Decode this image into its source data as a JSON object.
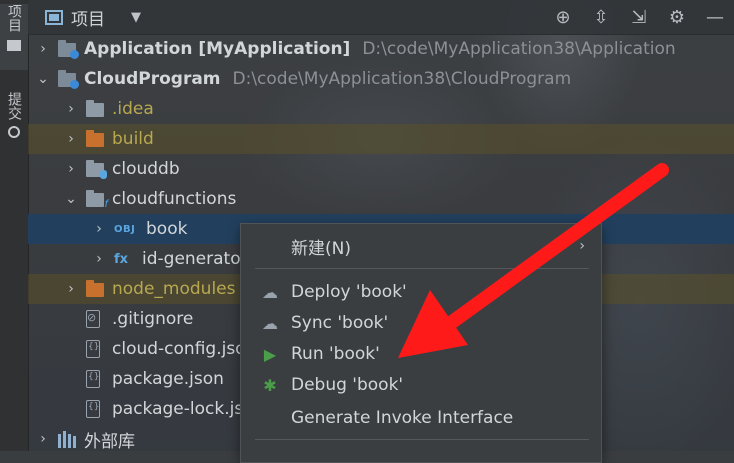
{
  "sidebar": {
    "tabs": [
      {
        "label": "项目",
        "icon": "folder-icon"
      },
      {
        "label": "提交",
        "icon": "commit-icon"
      }
    ]
  },
  "toolbar": {
    "title": "项目",
    "buttons": [
      "target-icon",
      "expand-all-icon",
      "collapse-all-icon",
      "gear-icon",
      "minimize-icon"
    ]
  },
  "tree": {
    "rows": [
      {
        "name": "Application [MyApplication]",
        "path": "D:\\code\\MyApplication38\\Application"
      },
      {
        "name": "CloudProgram",
        "path": "D:\\code\\MyApplication38\\CloudProgram"
      },
      {
        "name": ".idea"
      },
      {
        "name": "build"
      },
      {
        "name": "clouddb"
      },
      {
        "name": "cloudfunctions"
      },
      {
        "name": "book",
        "badge": "OBJ"
      },
      {
        "name": "id-generator",
        "badge": "fx"
      },
      {
        "name": "node_modules"
      },
      {
        "name": ".gitignore"
      },
      {
        "name": "cloud-config.json"
      },
      {
        "name": "package.json"
      },
      {
        "name": "package-lock.json"
      },
      {
        "name": "外部库"
      }
    ]
  },
  "context_menu": {
    "items": [
      {
        "label": "新建(N)"
      },
      {
        "label": "Deploy 'book'"
      },
      {
        "label": "Sync 'book'"
      },
      {
        "label": "Run 'book'"
      },
      {
        "label": "Debug 'book'"
      },
      {
        "label": "Generate Invoke Interface"
      }
    ]
  },
  "colors": {
    "selection": "#214060",
    "annotation_arrow": "#ff1a1a",
    "run_green": "#4a9e4a",
    "excluded_folder": "#c8712e"
  }
}
